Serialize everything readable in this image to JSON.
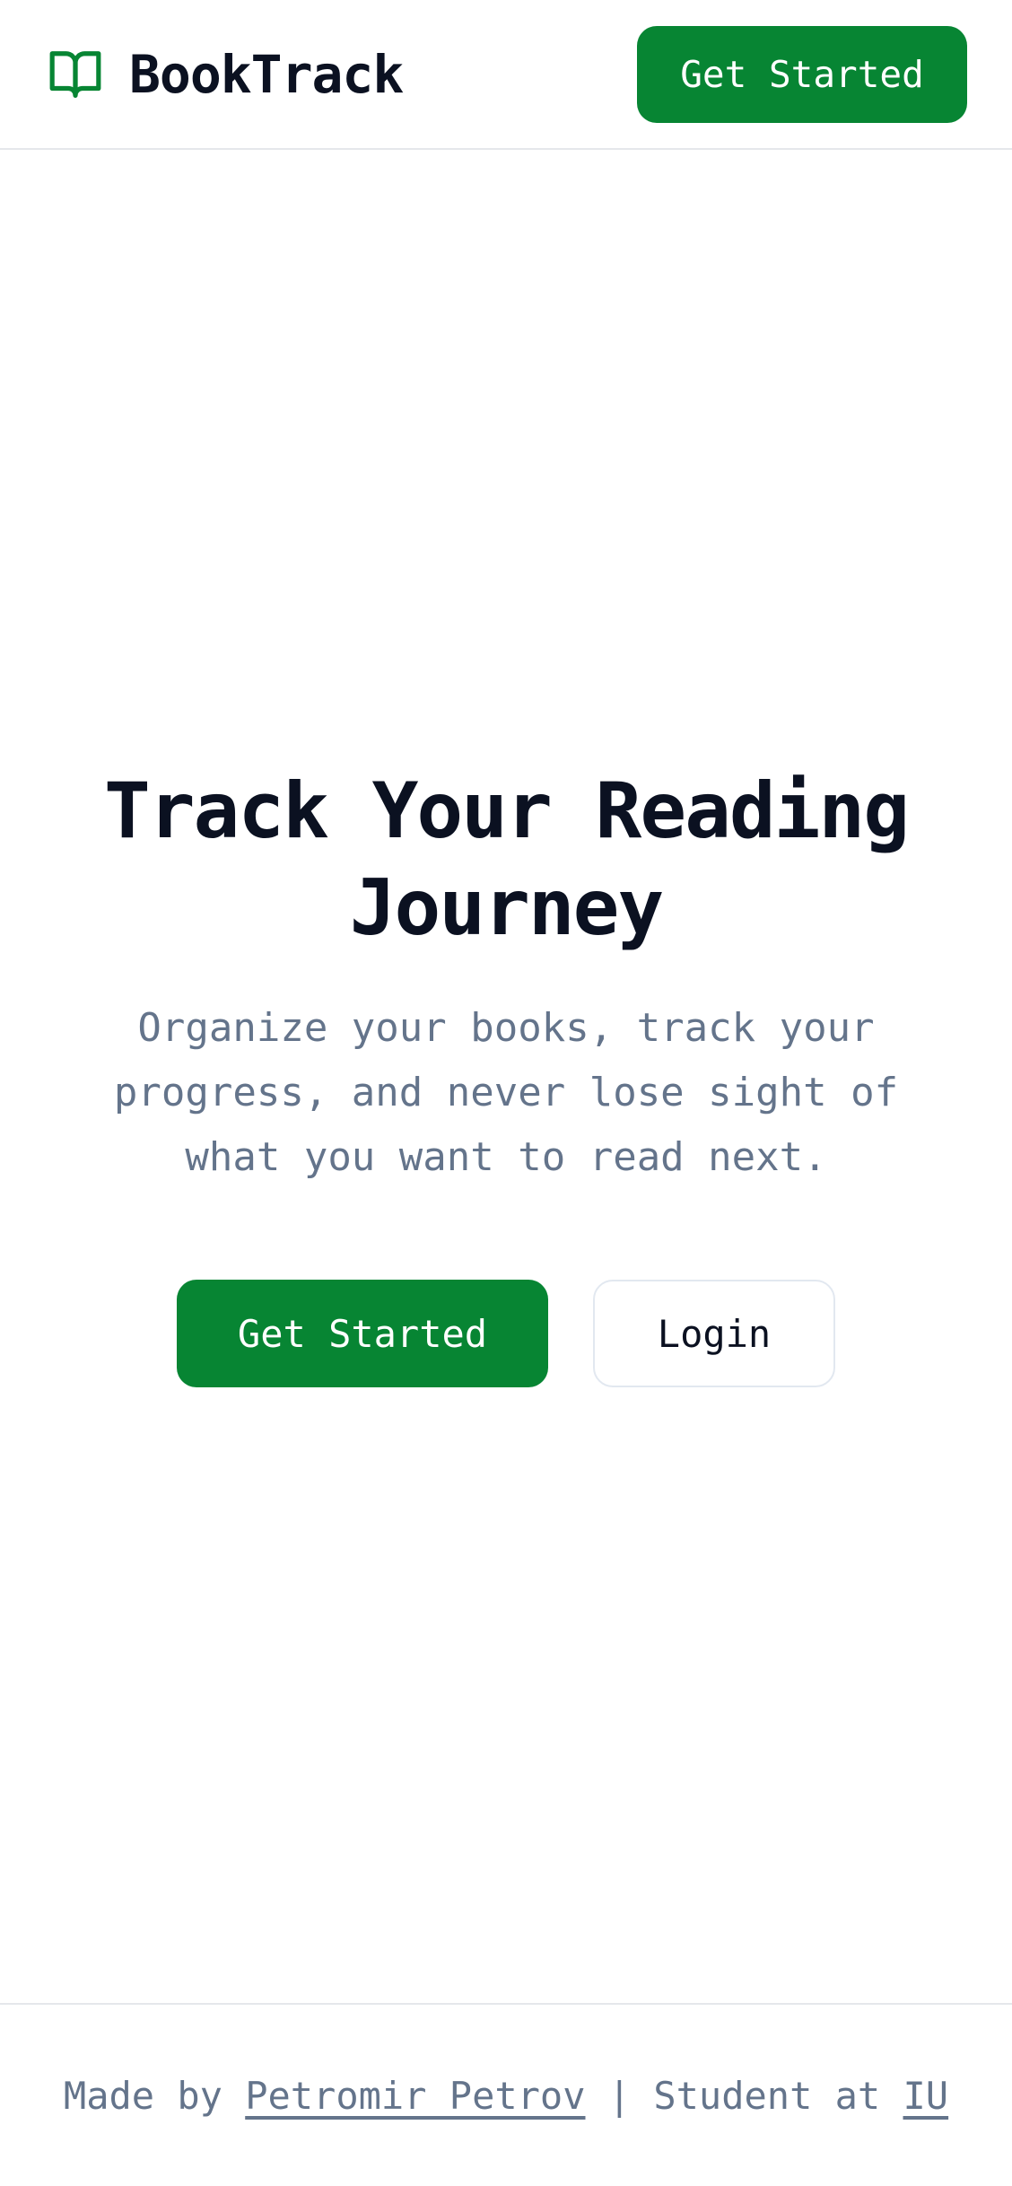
{
  "header": {
    "brand_icon": "open-book-icon",
    "brand_name": "BookTrack",
    "cta_label": "Get Started"
  },
  "hero": {
    "title": "Track Your Reading Journey",
    "subtitle": "Organize your books, track your progress, and never lose sight of what you want to read next.",
    "primary_label": "Get Started",
    "secondary_label": "Login"
  },
  "footer": {
    "prefix": "Made by ",
    "author_link": "Petromir Petrov",
    "separator": " | Student at ",
    "school_link": "IU"
  },
  "colors": {
    "accent": "#078533",
    "text_primary": "#0b1121",
    "text_muted": "#64748b",
    "border": "#e5e7eb"
  }
}
